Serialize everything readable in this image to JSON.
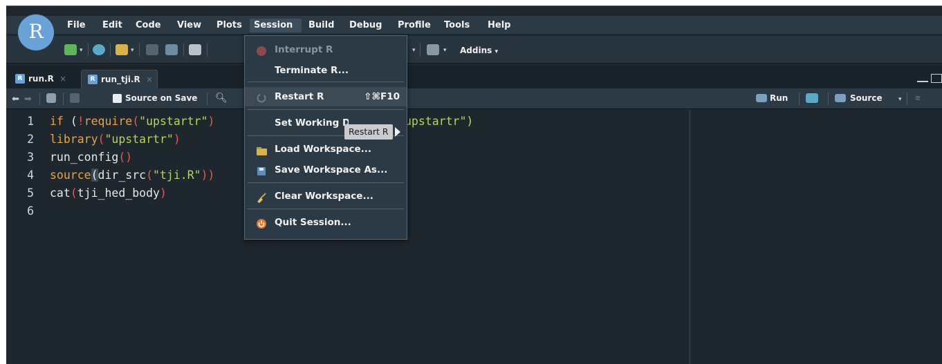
{
  "logo": {
    "letter": "R"
  },
  "menubar": {
    "items": [
      "File",
      "Edit",
      "Code",
      "View",
      "Plots",
      "Session",
      "Build",
      "Debug",
      "Profile",
      "Tools",
      "Help"
    ],
    "active": "Session"
  },
  "toolbar": {
    "addins_label": "Addins"
  },
  "tabs": [
    {
      "label": "run.R",
      "close": "×",
      "selected": false
    },
    {
      "label": "run_tji.R",
      "close": "×",
      "selected": true
    }
  ],
  "editor_toolbar": {
    "source_on_save": "Source on Save",
    "run": "Run",
    "source": "Source"
  },
  "editor": {
    "lines": [
      {
        "num": "1",
        "tokens": [
          {
            "t": "if ",
            "c": "kw"
          },
          {
            "t": "(",
            "c": "paren"
          },
          {
            "t": "!",
            "c": "op"
          },
          {
            "t": "require",
            "c": "fn"
          },
          {
            "t": "(",
            "c": "op"
          },
          {
            "t": "\"upstartr\"",
            "c": "str"
          },
          {
            "t": ")",
            "c": "op"
          }
        ]
      },
      {
        "num": "2",
        "tokens": [
          {
            "t": "library",
            "c": "fn"
          },
          {
            "t": "(",
            "c": "op"
          },
          {
            "t": "\"upstartr\"",
            "c": "str"
          },
          {
            "t": ")",
            "c": "op"
          }
        ]
      },
      {
        "num": "3",
        "tokens": [
          {
            "t": "run_config",
            "c": "plain"
          },
          {
            "t": "()",
            "c": "op"
          }
        ]
      },
      {
        "num": "4",
        "tokens": [
          {
            "t": "source",
            "c": "fn"
          },
          {
            "t": "(",
            "c": "paren",
            "hl": true
          },
          {
            "t": "dir_src",
            "c": "plain"
          },
          {
            "t": "(",
            "c": "op"
          },
          {
            "t": "\"tji.R\"",
            "c": "str"
          },
          {
            "t": "))",
            "c": "op"
          }
        ]
      },
      {
        "num": "5",
        "tokens": [
          {
            "t": "cat",
            "c": "plain"
          },
          {
            "t": "(",
            "c": "op"
          },
          {
            "t": "tji_hed_body",
            "c": "plain"
          },
          {
            "t": ")",
            "c": "op"
          }
        ]
      },
      {
        "num": "6",
        "tokens": []
      }
    ],
    "line1_trailing": "upstartr\")"
  },
  "session_menu": {
    "items": [
      {
        "label": "Interrupt R",
        "disabled": true,
        "icon": "stop-icon"
      },
      {
        "label": "Terminate R...",
        "disabled": false,
        "icon": ""
      },
      {
        "label": "Restart R",
        "shortcut": "⇧⌘F10",
        "disabled": false,
        "icon": "restart-icon",
        "highlight": true
      },
      {
        "label": "Set Working Directory",
        "disabled": false,
        "icon": ""
      },
      {
        "label": "Load Workspace...",
        "disabled": false,
        "icon": "load-workspace-icon"
      },
      {
        "label": "Save Workspace As...",
        "disabled": false,
        "icon": "save-workspace-icon"
      },
      {
        "label": "Clear Workspace...",
        "disabled": false,
        "icon": "broom-icon"
      },
      {
        "label": "Quit Session...",
        "disabled": false,
        "icon": "power-icon"
      }
    ]
  },
  "tooltip": {
    "text": "Restart R"
  },
  "colors": {
    "background": "#1e272e",
    "menubar": "#2c3a45",
    "string": "#b6d35d",
    "keyword": "#e8a348",
    "operator": "#e05a4f"
  }
}
